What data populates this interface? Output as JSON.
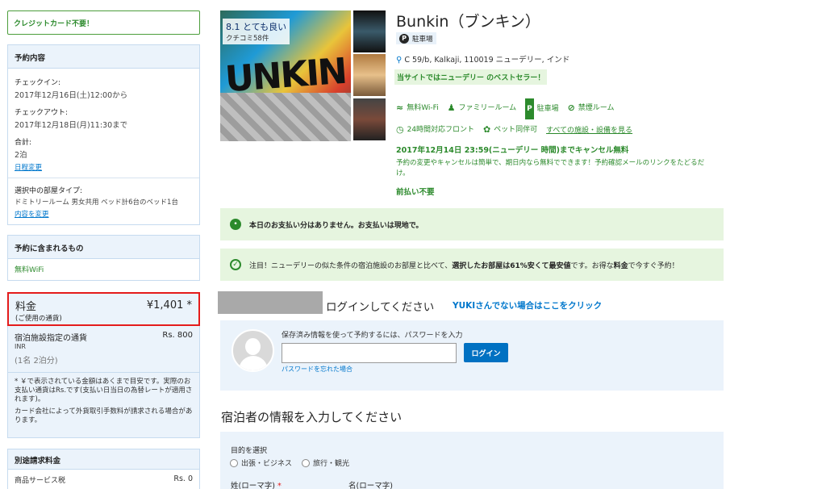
{
  "sidebar": {
    "no_card": "クレジットカード不要！",
    "booking": {
      "title": "予約内容",
      "checkin_label": "チェックイン:",
      "checkin_value": "2017年12月16日(土)12:00から",
      "checkout_label": "チェックアウト:",
      "checkout_value": "2017年12月18日(月)11:30まで",
      "total_label": "合計:",
      "total_value": "2泊",
      "change_dates": "日程変更",
      "room_label": "選択中の部屋タイプ:",
      "room_value": "ドミトリールーム 男女共用 ベッド計6台のベッド1台",
      "change_room": "内容を変更"
    },
    "included": {
      "title": "予約に含まれるもの",
      "wifi": "無料WiFi"
    },
    "price": {
      "label": "料金",
      "sub": "(ご使用の通貨)",
      "value": "¥1,401 *"
    },
    "currency": {
      "label": "宿泊施設指定の通貨",
      "code": "INR",
      "value": "Rs. 800",
      "guests": "(1名 2泊分)",
      "note1": "* ￥で表示されている金額はあくまで目安です。実際のお支払い通貨はRs.です(支払い日当日の為替レートが適用されます)。",
      "note2": "カード会社によって外貨取引手数料が請求される場合があります。"
    },
    "extra": {
      "title": "別途請求料金",
      "service_tax_label": "商品サービス税",
      "service_tax_value": "Rs. 0"
    }
  },
  "hotel": {
    "score": "8.1 とても良い",
    "reviews": "クチコミ58件",
    "name": "Bunkin（ブンキン）",
    "parking_tag": "駐車場",
    "address": "C 59/b, Kalkaji, 110019 ニューデリー, インド",
    "bestseller": "当サイトではニューデリー のベストセラー！",
    "amenities": [
      "無料Wi-Fi",
      "ファミリールーム",
      "駐車場",
      "禁煙ルーム",
      "24時間対応フロント",
      "ペット同伴可"
    ],
    "all_amenities": "すべての施設・設備を見る",
    "cancel_title": "2017年12月14日 23:59(ニューデリー 時間)までキャンセル無料",
    "cancel_desc": "予約の変更やキャンセルは簡単で、期日内なら無料でできます！予約確認メールのリンクをたどるだけ。",
    "prepay": "前払い不要"
  },
  "notices": {
    "pay_today": "本日のお支払い分はありません。お支払いは現地で。",
    "deal_prefix": "注目！ニューデリーの似た条件の宿泊施設のお部屋と比べて、",
    "deal_bold": "選択したお部屋は61%安くて最安値",
    "deal_mid": "です。お得な",
    "deal_bold2": "料金",
    "deal_suffix": "で今すぐ予約！"
  },
  "login": {
    "title": "ログインしてください",
    "not_user": "YUKIさんでない場合はここをクリック",
    "hint": "保存済み情報を使って予約するには、パスワードを入力",
    "button": "ログイン",
    "forgot": "パスワードを忘れた場合"
  },
  "guest_form": {
    "title": "宿泊者の情報を入力してください",
    "purpose_label": "目的を選択",
    "purpose_options": [
      "出張・ビジネス",
      "旅行・観光"
    ],
    "last_name_label": "姓(ローマ字)",
    "first_name_label": "名(ローマ字)",
    "required_mark": "*"
  },
  "colors": {
    "accent_blue": "#0071c2",
    "success_green": "#2c8a2c",
    "highlight_red": "#e41b1b",
    "panel_blue": "#ebf3fb",
    "notice_green": "#e6f5df"
  }
}
